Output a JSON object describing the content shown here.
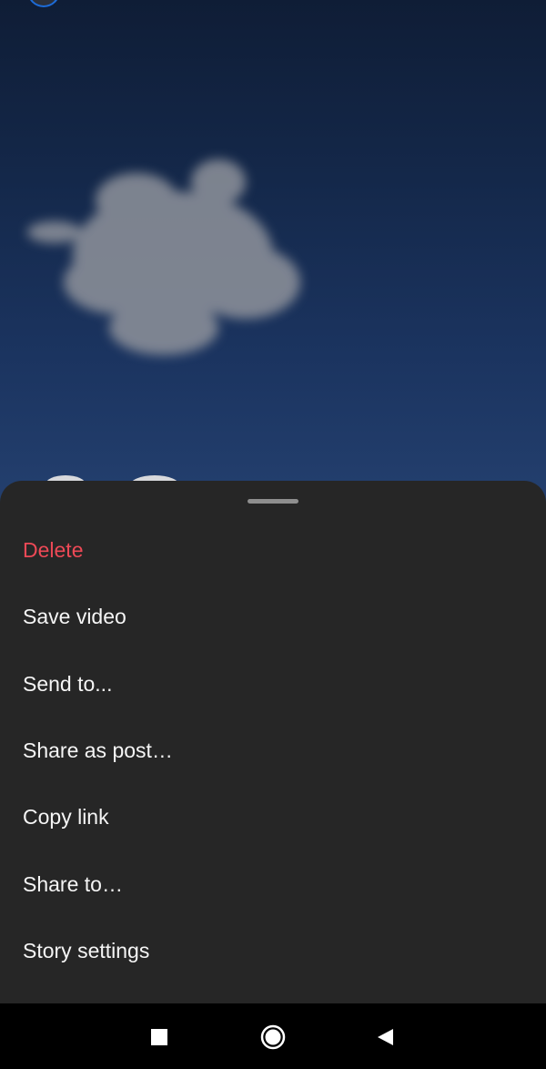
{
  "story": {
    "background_color": "#14284a"
  },
  "sheet": {
    "items": [
      {
        "label": "Delete",
        "style": "danger"
      },
      {
        "label": "Save video"
      },
      {
        "label": "Send to..."
      },
      {
        "label": "Share as post…"
      },
      {
        "label": "Copy link"
      },
      {
        "label": "Share to…"
      },
      {
        "label": "Story settings"
      }
    ],
    "danger_color": "#ed4956"
  },
  "navbar": {
    "icons": [
      "recents-icon",
      "home-icon",
      "back-icon"
    ]
  }
}
